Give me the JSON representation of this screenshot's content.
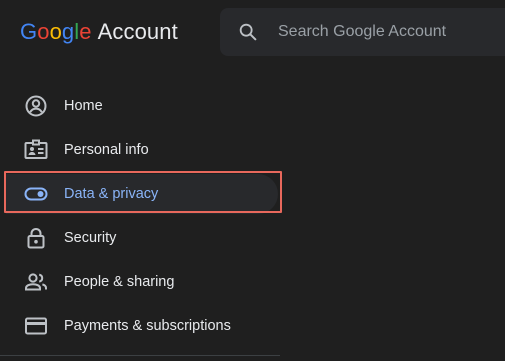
{
  "header": {
    "logo_letters": [
      "G",
      "o",
      "o",
      "g",
      "l",
      "e"
    ],
    "product_name": "Account"
  },
  "search": {
    "placeholder": "Search Google Account",
    "icon": "search-icon"
  },
  "nav": {
    "items": [
      {
        "label": "Home",
        "icon": "account-circle-icon",
        "active": false
      },
      {
        "label": "Personal info",
        "icon": "id-card-icon",
        "active": false
      },
      {
        "label": "Data & privacy",
        "icon": "toggle-icon",
        "active": true
      },
      {
        "label": "Security",
        "icon": "lock-icon",
        "active": false
      },
      {
        "label": "People & sharing",
        "icon": "people-icon",
        "active": false
      },
      {
        "label": "Payments & subscriptions",
        "icon": "credit-card-icon",
        "active": false
      }
    ]
  },
  "colors": {
    "background": "#1f1f1f",
    "text": "#e8eaed",
    "active_text": "#8ab4f8",
    "highlight": "#e8685c",
    "google_blue": "#4285f4",
    "google_red": "#ea4335",
    "google_yellow": "#fbbc05",
    "google_green": "#34a853"
  }
}
